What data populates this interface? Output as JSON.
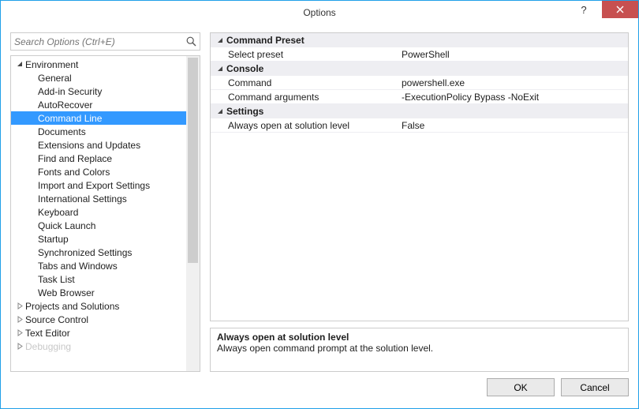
{
  "window": {
    "title": "Options",
    "help_glyph": "?",
    "help_label": "Help",
    "close_label": "Close"
  },
  "search": {
    "placeholder": "Search Options (Ctrl+E)"
  },
  "tree": {
    "items": [
      {
        "label": "Environment",
        "level": 0,
        "expander": "open",
        "selected": false
      },
      {
        "label": "General",
        "level": 1,
        "expander": "none",
        "selected": false
      },
      {
        "label": "Add-in Security",
        "level": 1,
        "expander": "none",
        "selected": false
      },
      {
        "label": "AutoRecover",
        "level": 1,
        "expander": "none",
        "selected": false
      },
      {
        "label": "Command Line",
        "level": 1,
        "expander": "none",
        "selected": true
      },
      {
        "label": "Documents",
        "level": 1,
        "expander": "none",
        "selected": false
      },
      {
        "label": "Extensions and Updates",
        "level": 1,
        "expander": "none",
        "selected": false
      },
      {
        "label": "Find and Replace",
        "level": 1,
        "expander": "none",
        "selected": false
      },
      {
        "label": "Fonts and Colors",
        "level": 1,
        "expander": "none",
        "selected": false
      },
      {
        "label": "Import and Export Settings",
        "level": 1,
        "expander": "none",
        "selected": false
      },
      {
        "label": "International Settings",
        "level": 1,
        "expander": "none",
        "selected": false
      },
      {
        "label": "Keyboard",
        "level": 1,
        "expander": "none",
        "selected": false
      },
      {
        "label": "Quick Launch",
        "level": 1,
        "expander": "none",
        "selected": false
      },
      {
        "label": "Startup",
        "level": 1,
        "expander": "none",
        "selected": false
      },
      {
        "label": "Synchronized Settings",
        "level": 1,
        "expander": "none",
        "selected": false
      },
      {
        "label": "Tabs and Windows",
        "level": 1,
        "expander": "none",
        "selected": false
      },
      {
        "label": "Task List",
        "level": 1,
        "expander": "none",
        "selected": false
      },
      {
        "label": "Web Browser",
        "level": 1,
        "expander": "none",
        "selected": false
      },
      {
        "label": "Projects and Solutions",
        "level": 0,
        "expander": "closed",
        "selected": false
      },
      {
        "label": "Source Control",
        "level": 0,
        "expander": "closed",
        "selected": false
      },
      {
        "label": "Text Editor",
        "level": 0,
        "expander": "closed",
        "selected": false
      },
      {
        "label": "Debugging",
        "level": 0,
        "expander": "closed",
        "selected": false,
        "faded": true
      }
    ]
  },
  "propgrid": {
    "sections": [
      {
        "title": "Command Preset",
        "rows": [
          {
            "name": "Select preset",
            "value": "PowerShell"
          }
        ]
      },
      {
        "title": "Console",
        "rows": [
          {
            "name": "Command",
            "value": "powershell.exe"
          },
          {
            "name": "Command arguments",
            "value": "-ExecutionPolicy Bypass -NoExit"
          }
        ]
      },
      {
        "title": "Settings",
        "rows": [
          {
            "name": "Always open at solution level",
            "value": "False"
          }
        ]
      }
    ]
  },
  "description": {
    "heading": "Always open at solution level",
    "text": "Always open command prompt at the solution level."
  },
  "buttons": {
    "ok": "OK",
    "cancel": "Cancel"
  }
}
